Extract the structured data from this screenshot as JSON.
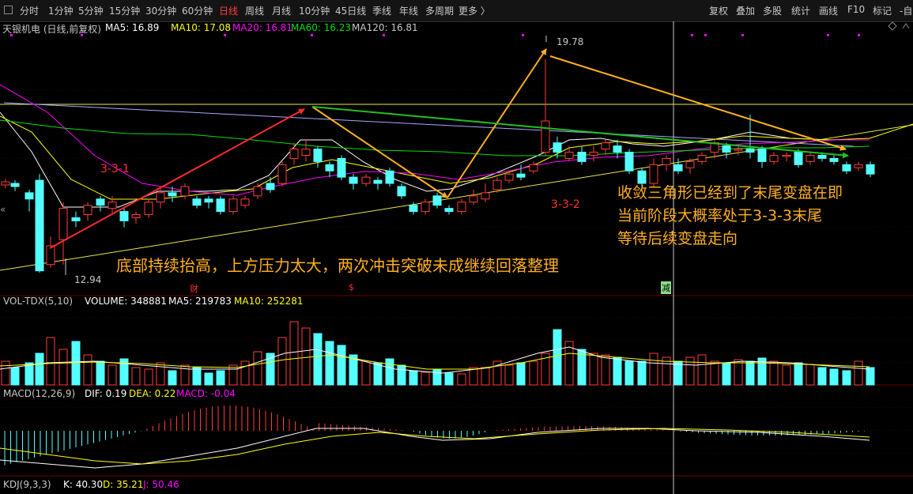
{
  "toolbar": {
    "periods": [
      "分时",
      "1分钟",
      "5分钟",
      "15分钟",
      "30分钟",
      "60分钟",
      "日线",
      "周线",
      "月线",
      "10分钟",
      "45日线",
      "季线",
      "年线",
      "多周期",
      "更多 〉"
    ],
    "active": "日线",
    "right": [
      "复权",
      "叠加",
      "多股",
      "统计",
      "画线",
      "F10",
      "标记",
      "-自"
    ]
  },
  "stock": {
    "name": "天银机电 (日线,前复权)",
    "ma5": "MA5: 16.89",
    "ma10": "MA10: 17.08",
    "ma20": "MA20: 16.81",
    "ma60": "MA60: 16.23",
    "ma120": "MA120: 16.81",
    "high_label": "19.78",
    "low_label": "12.94",
    "marker_cai": "财",
    "marker_s": "$",
    "marker_jian": "减",
    "side_arrow": "«"
  },
  "volume": {
    "name": "VOL-TDX(5,10)",
    "volume": "VOLUME: 348881",
    "ma5": "MA5: 219783",
    "ma10": "MA10: 252281"
  },
  "macd": {
    "name": "MACD(12,26,9)",
    "dif": "DIF: 0.19",
    "dea": "DEA: 0.22",
    "macd": "MACD: -0.04"
  },
  "kdj": {
    "name": "KDJ(9,3,3)",
    "k": "K: 40.30",
    "d": "D: 35.21",
    "j": "J: 50.46"
  },
  "annotations": {
    "wave1": "3-3-1",
    "wave2": "3-3-2",
    "note1": "收敛三角形已经到了末尾变盘在即",
    "note2": "当前阶段大概率处于3-3-3末尾",
    "note3": "等待后续变盘走向",
    "bottom_note": "底部持续抬高，上方压力太大，两次冲击突破未成继续回落整理"
  },
  "colors": {
    "up": "#ff3b3b",
    "down": "#54ffff",
    "ma5": "#ffffff",
    "ma10": "#ffff00",
    "ma20": "#ff00ff",
    "ma60": "#00e000",
    "annotation": "#ffb020"
  }
}
